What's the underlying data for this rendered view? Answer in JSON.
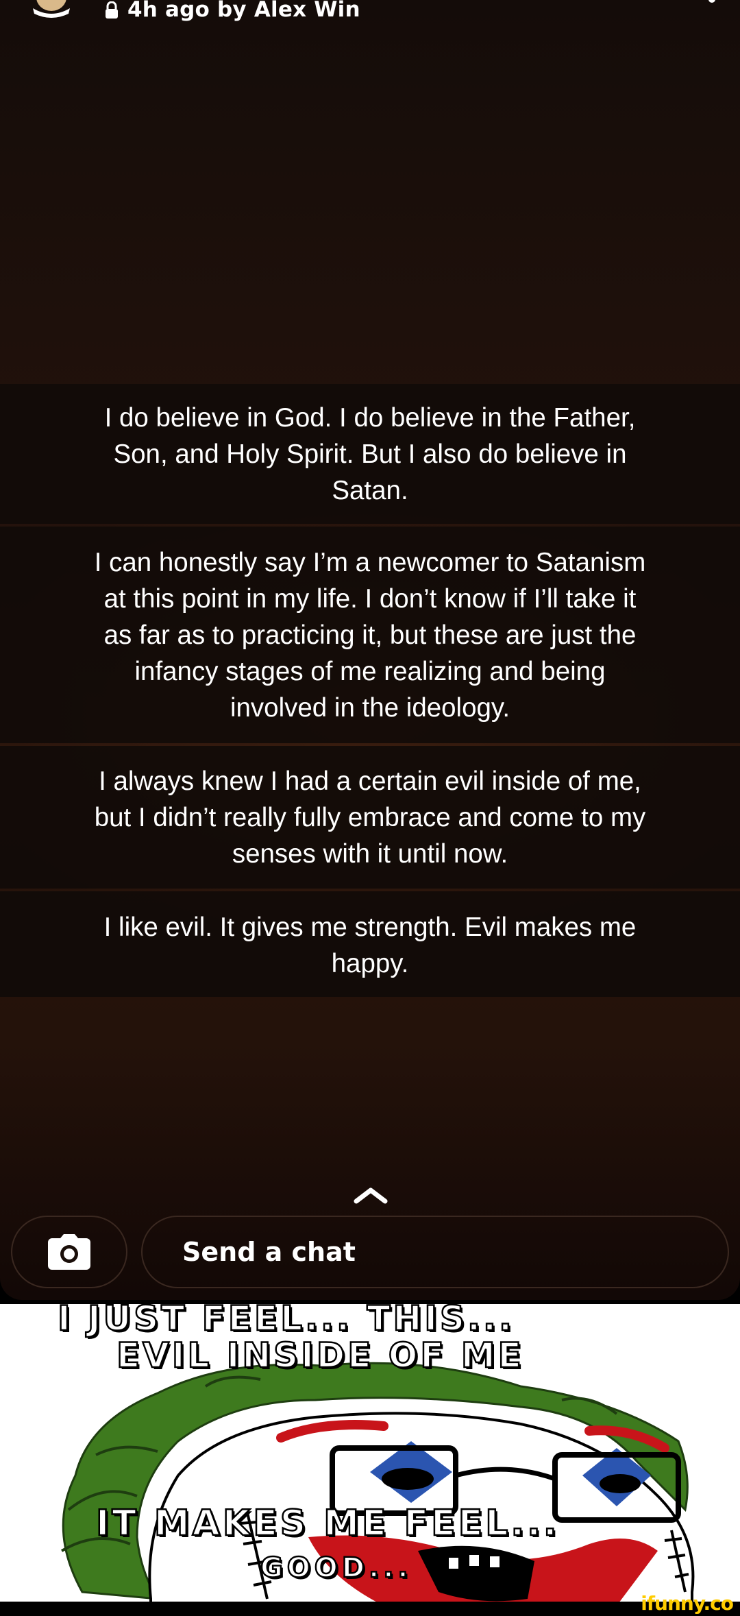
{
  "story": {
    "byline": "4h ago by Alex Win",
    "paragraphs": [
      [
        "I do believe in God. I do believe in the Father,",
        "Son, and Holy Spirit. But I also do believe in",
        "Satan."
      ],
      [
        "I can honestly say I’m a newcomer to Satanism",
        "at this point in my life. I don’t know if I’ll take it",
        "as far as to practicing it, but these are just the",
        "infancy stages of me realizing and being",
        "involved in the ideology."
      ],
      [
        "I always knew I had a certain evil inside of me,",
        "but I didn’t really fully embrace and come to my",
        "senses with it until now."
      ],
      [
        "I like evil. It gives me strength. Evil makes me",
        "happy."
      ]
    ],
    "chat_placeholder": "Send a chat",
    "icons": [
      "avatar",
      "lock-icon",
      "chevron-up-icon",
      "camera-icon"
    ]
  },
  "meme": {
    "caption_line1": "I JUST FEEL... THIS...",
    "caption_line2": "EVIL INSIDE OF ME",
    "caption_line3": "IT MAKES ME FEEL...",
    "caption_line4": "GOOD..."
  },
  "watermark": "ifunny.co",
  "colors": {
    "hair": "#3e7a1e",
    "clown_red": "#c8141a",
    "clown_blue": "#2b55b0",
    "text_overlay": "#100a08"
  }
}
